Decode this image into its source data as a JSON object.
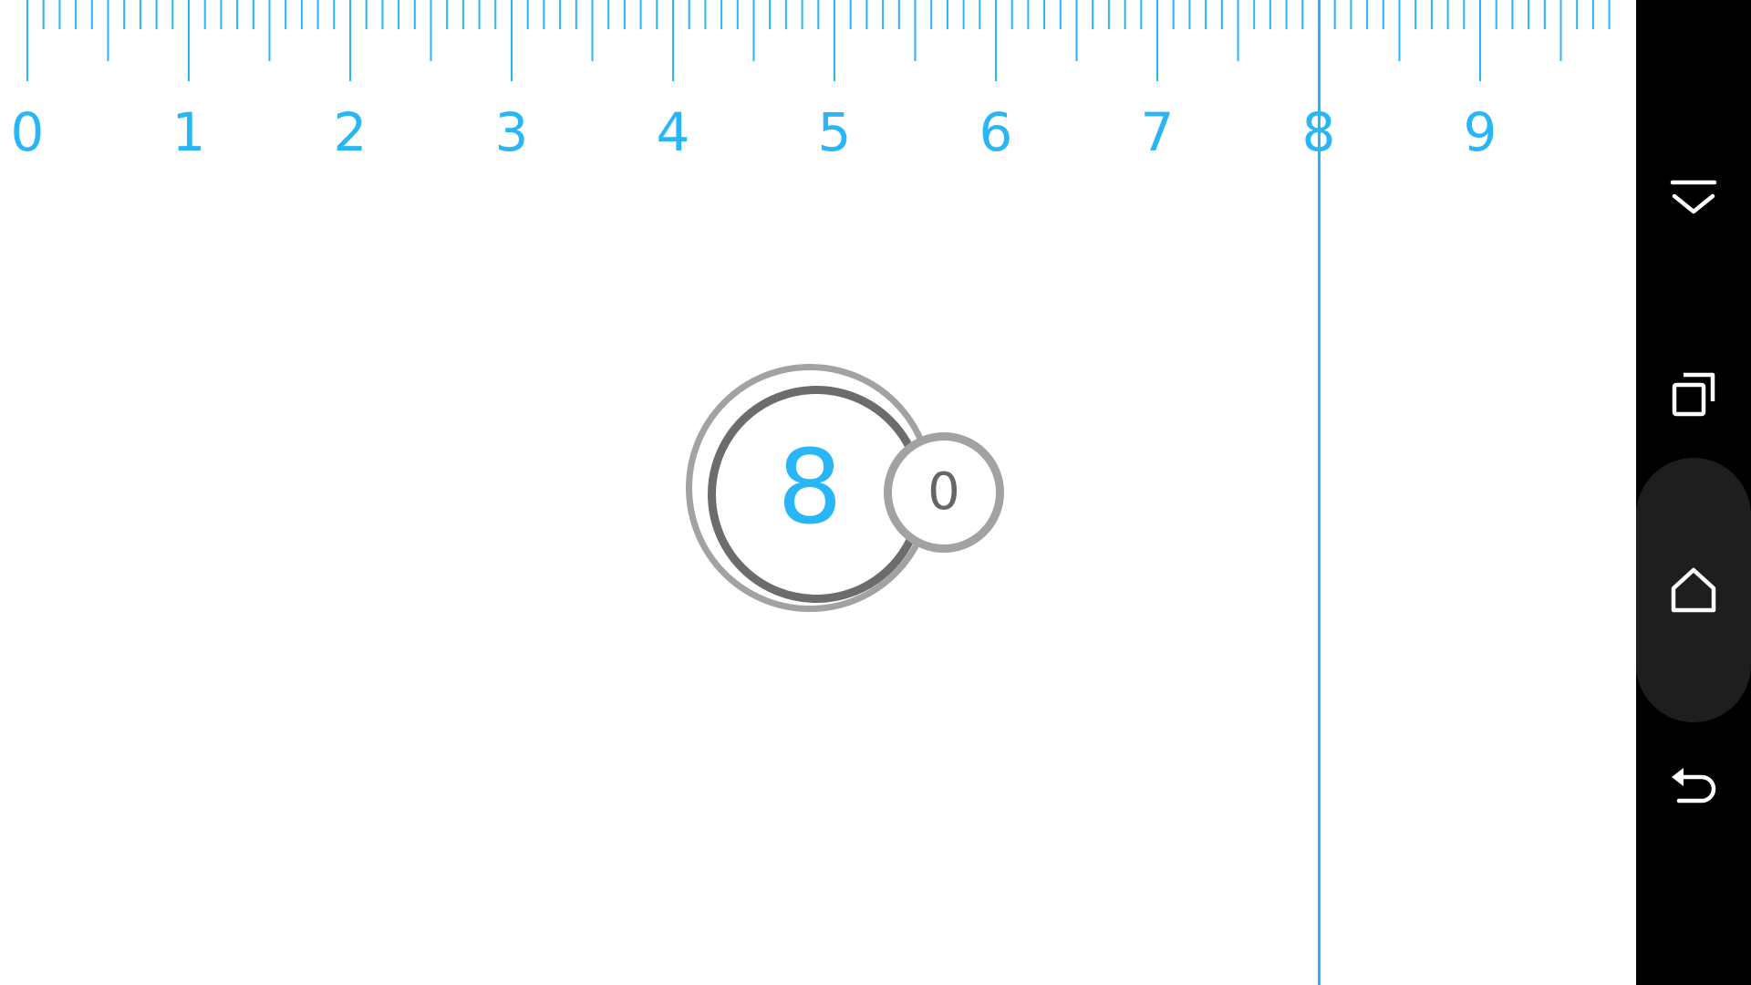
{
  "ruler": {
    "labels": [
      "0",
      "1",
      "2",
      "3",
      "4",
      "5",
      "6",
      "7",
      "8",
      "9"
    ],
    "units_visible": 9.8,
    "minor_divisions": 10,
    "accent_color": "#29b6f6"
  },
  "measurement": {
    "position": 8.0,
    "integer": "8",
    "fraction": "0"
  },
  "navbar": {
    "icons": [
      "collapse-icon",
      "recent-apps-icon",
      "home-icon",
      "back-icon"
    ]
  }
}
